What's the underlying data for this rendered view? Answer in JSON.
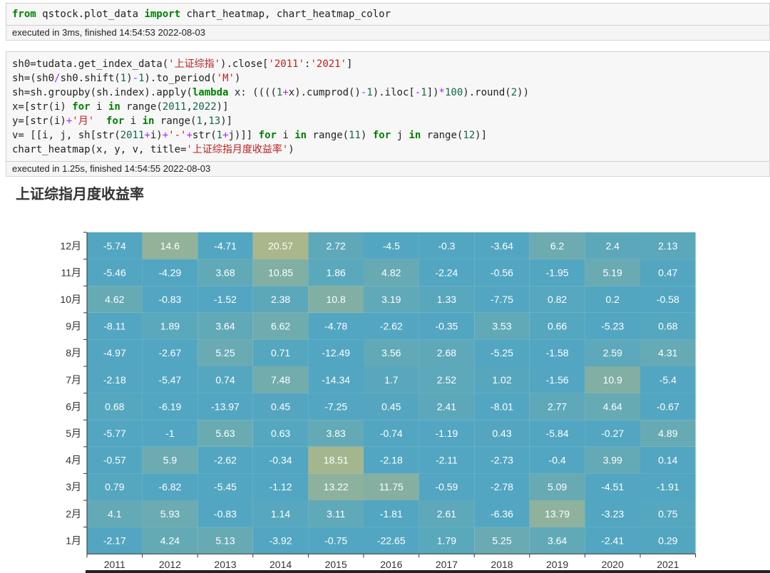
{
  "cells": [
    {
      "code_lines": [
        [
          {
            "t": "from",
            "c": "kw"
          },
          {
            "t": " qstock.plot_data ",
            "c": ""
          },
          {
            "t": "import",
            "c": "kw"
          },
          {
            "t": " chart_heatmap, chart_heatmap_color",
            "c": ""
          }
        ]
      ],
      "status": "executed in 3ms, finished 14:54:53 2022-08-03"
    },
    {
      "code_lines": [
        [
          {
            "t": "sh0=tudata.get_index_data(",
            "c": ""
          },
          {
            "t": "'上证综指'",
            "c": "str"
          },
          {
            "t": ").close[",
            "c": ""
          },
          {
            "t": "'2011'",
            "c": "str"
          },
          {
            "t": ":",
            "c": ""
          },
          {
            "t": "'2021'",
            "c": "str"
          },
          {
            "t": "]",
            "c": ""
          }
        ],
        [
          {
            "t": "sh=(sh0",
            "c": ""
          },
          {
            "t": "/",
            "c": "op"
          },
          {
            "t": "sh0.shift(",
            "c": ""
          },
          {
            "t": "1",
            "c": "num"
          },
          {
            "t": ")",
            "c": ""
          },
          {
            "t": "-",
            "c": "op"
          },
          {
            "t": "1",
            "c": "num"
          },
          {
            "t": ").to_period(",
            "c": ""
          },
          {
            "t": "'M'",
            "c": "str"
          },
          {
            "t": ")",
            "c": ""
          }
        ],
        [
          {
            "t": "sh=sh.groupby(sh.index).apply(",
            "c": ""
          },
          {
            "t": "lambda",
            "c": "kw"
          },
          {
            "t": " x: ((((",
            "c": ""
          },
          {
            "t": "1",
            "c": "num"
          },
          {
            "t": "+",
            "c": "op"
          },
          {
            "t": "x).cumprod()",
            "c": ""
          },
          {
            "t": "-",
            "c": "op"
          },
          {
            "t": "1",
            "c": "num"
          },
          {
            "t": ").iloc[",
            "c": ""
          },
          {
            "t": "-",
            "c": "op"
          },
          {
            "t": "1",
            "c": "num"
          },
          {
            "t": "])",
            "c": ""
          },
          {
            "t": "*",
            "c": "op"
          },
          {
            "t": "100",
            "c": "num"
          },
          {
            "t": ").round(",
            "c": ""
          },
          {
            "t": "2",
            "c": "num"
          },
          {
            "t": "))",
            "c": ""
          }
        ],
        [
          {
            "t": "x=[str(i) ",
            "c": ""
          },
          {
            "t": "for",
            "c": "kw"
          },
          {
            "t": " i ",
            "c": ""
          },
          {
            "t": "in",
            "c": "kw"
          },
          {
            "t": " range(",
            "c": ""
          },
          {
            "t": "2011",
            "c": "num"
          },
          {
            "t": ",",
            "c": ""
          },
          {
            "t": "2022",
            "c": "num"
          },
          {
            "t": ")]",
            "c": ""
          }
        ],
        [
          {
            "t": "y=[str(i)",
            "c": ""
          },
          {
            "t": "+",
            "c": "op"
          },
          {
            "t": "'月'",
            "c": "str"
          },
          {
            "t": "  ",
            "c": ""
          },
          {
            "t": "for",
            "c": "kw"
          },
          {
            "t": " i ",
            "c": ""
          },
          {
            "t": "in",
            "c": "kw"
          },
          {
            "t": " range(",
            "c": ""
          },
          {
            "t": "1",
            "c": "num"
          },
          {
            "t": ",",
            "c": ""
          },
          {
            "t": "13",
            "c": "num"
          },
          {
            "t": ")]",
            "c": ""
          }
        ],
        [
          {
            "t": "v= [[i, j, sh[str(",
            "c": ""
          },
          {
            "t": "2011",
            "c": "num"
          },
          {
            "t": "+",
            "c": "op"
          },
          {
            "t": "i)",
            "c": ""
          },
          {
            "t": "+",
            "c": "op"
          },
          {
            "t": "'-'",
            "c": "str"
          },
          {
            "t": "+",
            "c": "op"
          },
          {
            "t": "str(",
            "c": ""
          },
          {
            "t": "1",
            "c": "num"
          },
          {
            "t": "+",
            "c": "op"
          },
          {
            "t": "j)]] ",
            "c": ""
          },
          {
            "t": "for",
            "c": "kw"
          },
          {
            "t": " i ",
            "c": ""
          },
          {
            "t": "in",
            "c": "kw"
          },
          {
            "t": " range(",
            "c": ""
          },
          {
            "t": "11",
            "c": "num"
          },
          {
            "t": ") ",
            "c": ""
          },
          {
            "t": "for",
            "c": "kw"
          },
          {
            "t": " j ",
            "c": ""
          },
          {
            "t": "in",
            "c": "kw"
          },
          {
            "t": " range(",
            "c": ""
          },
          {
            "t": "12",
            "c": "num"
          },
          {
            "t": ")]",
            "c": ""
          }
        ],
        [
          {
            "t": "chart_heatmap(x, y, v, title=",
            "c": ""
          },
          {
            "t": "'上证综指月度收益率'",
            "c": "str"
          },
          {
            "t": ")",
            "c": ""
          }
        ]
      ],
      "status": "executed in 1.25s, finished 14:54:55 2022-08-03"
    }
  ],
  "chart_data": {
    "type": "heatmap",
    "title": "上证综指月度收益率",
    "x": [
      "2011",
      "2012",
      "2013",
      "2014",
      "2015",
      "2016",
      "2017",
      "2018",
      "2019",
      "2020",
      "2021"
    ],
    "y": [
      "1月",
      "2月",
      "3月",
      "4月",
      "5月",
      "6月",
      "7月",
      "8月",
      "9月",
      "10月",
      "11月",
      "12月"
    ],
    "values": [
      [
        -2.17,
        4.1,
        0.79,
        -0.57,
        -5.77,
        0.68,
        -2.18,
        -4.97,
        -8.11,
        4.62,
        -5.46,
        -5.74
      ],
      [
        4.24,
        5.93,
        -6.82,
        5.9,
        -1,
        -6.19,
        -5.47,
        -2.67,
        1.89,
        -0.83,
        -4.29,
        14.6
      ],
      [
        5.13,
        -0.83,
        -5.45,
        -2.62,
        5.63,
        -13.97,
        0.74,
        5.25,
        3.64,
        -1.52,
        3.68,
        -4.71
      ],
      [
        -3.92,
        1.14,
        -1.12,
        -0.34,
        0.63,
        0.45,
        7.48,
        0.71,
        6.62,
        2.38,
        10.85,
        20.57
      ],
      [
        -0.75,
        3.11,
        13.22,
        18.51,
        3.83,
        -7.25,
        -14.34,
        -12.49,
        -4.78,
        10.8,
        1.86,
        2.72
      ],
      [
        -22.65,
        -1.81,
        11.75,
        -2.18,
        -0.74,
        0.45,
        1.7,
        3.56,
        -2.62,
        3.19,
        4.82,
        -4.5
      ],
      [
        1.79,
        2.61,
        -0.59,
        -2.11,
        -1.19,
        2.41,
        2.52,
        2.68,
        -0.35,
        1.33,
        -2.24,
        -0.3
      ],
      [
        5.25,
        -6.36,
        -2.78,
        -2.73,
        0.43,
        -8.01,
        1.02,
        -5.25,
        3.53,
        -7.75,
        -0.56,
        -3.64
      ],
      [
        3.64,
        13.79,
        5.09,
        -0.4,
        -5.84,
        2.77,
        -1.56,
        -1.58,
        0.66,
        0.82,
        -1.95,
        6.2
      ],
      [
        -2.41,
        -3.23,
        -4.51,
        3.99,
        -0.27,
        4.64,
        10.9,
        2.59,
        -5.23,
        0.2,
        5.19,
        2.4
      ],
      [
        0.29,
        0.75,
        -1.91,
        0.14,
        4.89,
        -0.67,
        -5.4,
        4.31,
        0.68,
        -0.58,
        0.47,
        2.13
      ]
    ],
    "values_note_order": "values[i][j] = year x[i], month y[j]",
    "colors": {
      "low": "#52a6c1",
      "high": "#a9b78a",
      "label": "#ffffff",
      "axis": "#333333"
    },
    "legend": "none",
    "grid": false
  }
}
